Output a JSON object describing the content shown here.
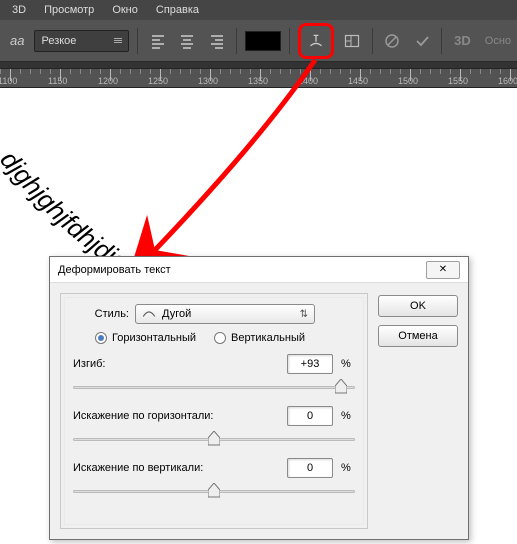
{
  "menu": {
    "items": [
      "3D",
      "Просмотр",
      "Окно",
      "Справка"
    ]
  },
  "options": {
    "aa_label": "aа",
    "antialias_value": "Резкое",
    "threeD": "3D",
    "extra": "Осно"
  },
  "ruler": {
    "start": 1050,
    "step": 50,
    "count": 14
  },
  "warped_text": "djghjghjfdhjdjgjdjjk",
  "dialog": {
    "title": "Деформировать текст",
    "close_glyph": "✕",
    "style_label": "Стиль:",
    "style_value": "Дугой",
    "orient_h": "Горизонтальный",
    "orient_v": "Вертикальный",
    "orient_selected": "h",
    "bend_label": "Изгиб:",
    "bend_value": "+93",
    "hdist_label": "Искажение по горизонтали:",
    "hdist_value": "0",
    "vdist_label": "Искажение по вертикали:",
    "vdist_value": "0",
    "pct": "%",
    "ok": "OK",
    "cancel": "Отмена"
  }
}
